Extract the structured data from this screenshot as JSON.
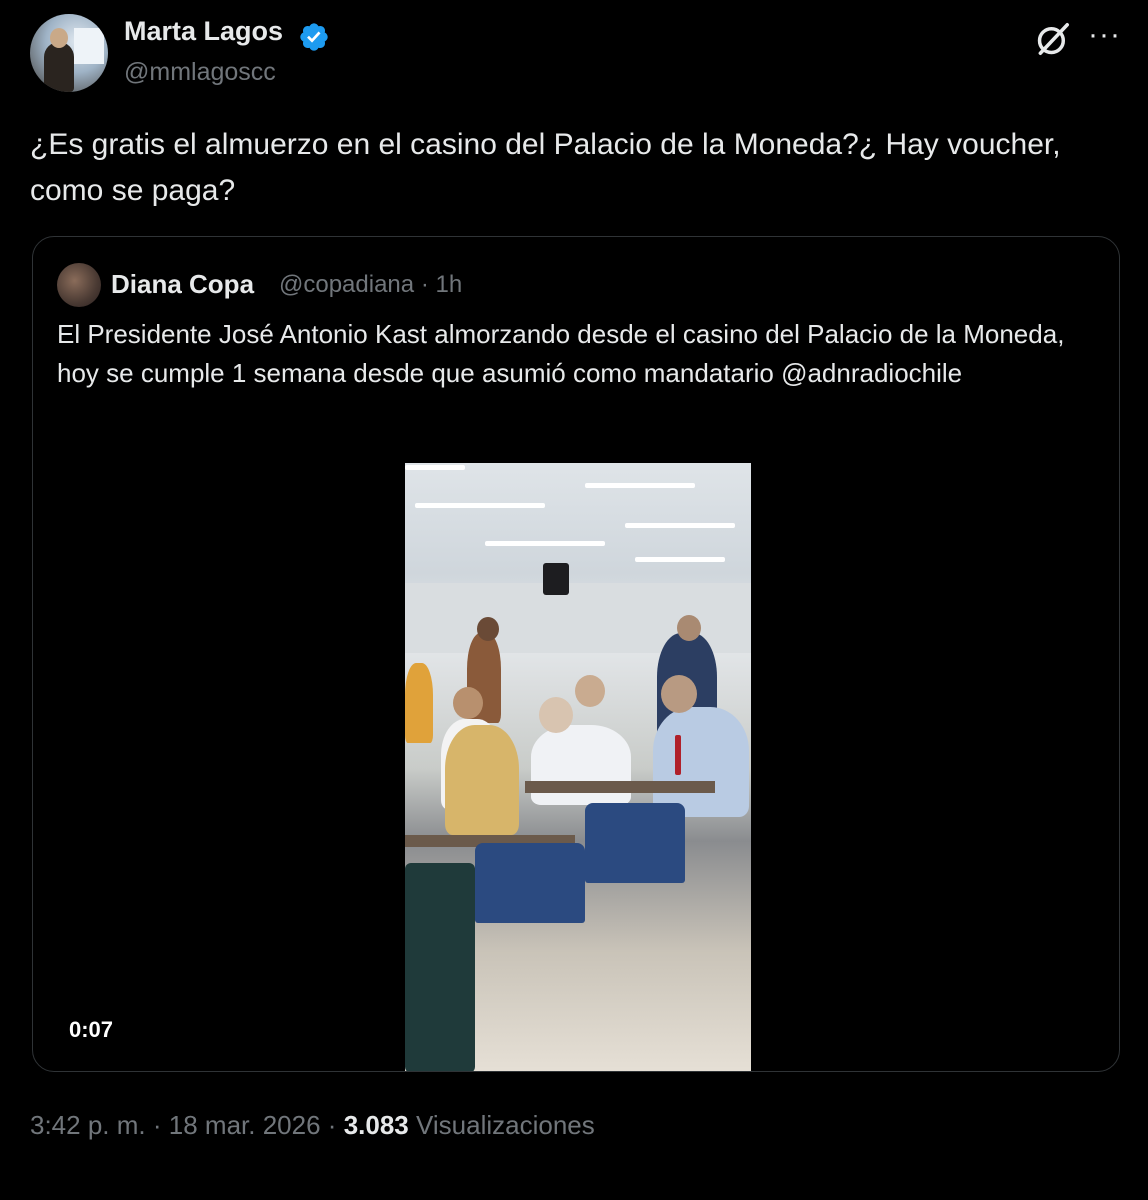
{
  "author": {
    "name": "Marta Lagos",
    "handle": "@mmlagoscc",
    "verified": true,
    "verified_color": "#1d9bf0"
  },
  "icons": {
    "grok": "grok-icon",
    "more": "more-icon",
    "more_glyph": "···"
  },
  "tweet": {
    "text": "¿Es gratis el almuerzo en el casino del Palacio de la Moneda?¿ Hay voucher, como se paga?"
  },
  "quote": {
    "name": "Diana Copa",
    "handle": "@copadiana",
    "separator": "·",
    "time": "1h",
    "text": "El Presidente José Antonio Kast almorzando desde el casino del Palacio de la Moneda, hoy se cumple 1 semana desde que asumió como mandatario @adnradiochile",
    "video_duration": "0:07"
  },
  "footer": {
    "time": "3:42 p. m.",
    "separator": "·",
    "date": "18 mar. 2026",
    "views_count": "3.083",
    "views_label": "Visualizaciones"
  },
  "colors": {
    "background": "#000000",
    "text": "#e7e9ea",
    "muted": "#71767b",
    "border": "#2f3336"
  }
}
